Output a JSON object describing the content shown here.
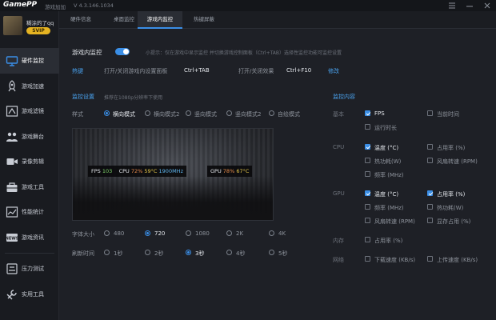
{
  "titlebar": {
    "logo": "GamePP",
    "app_name": "游戏加加",
    "version": "V 4.3.146.1034"
  },
  "user": {
    "name": "糊涂的了qq",
    "badge": "SVIP"
  },
  "sidebar": {
    "items": [
      {
        "label": "硬件监控",
        "icon": "monitor-icon"
      },
      {
        "label": "游戏加速",
        "icon": "rocket-icon"
      },
      {
        "label": "游戏滤镜",
        "icon": "filter-icon"
      },
      {
        "label": "游戏舞台",
        "icon": "stage-icon"
      },
      {
        "label": "录像剪辑",
        "icon": "video-icon"
      },
      {
        "label": "游戏工具",
        "icon": "toolbox-icon"
      },
      {
        "label": "性能统计",
        "icon": "chart-icon"
      },
      {
        "label": "游戏资讯",
        "icon": "news-icon"
      },
      {
        "label": "压力测试",
        "icon": "pressure-icon"
      },
      {
        "label": "实用工具",
        "icon": "tools-icon"
      }
    ]
  },
  "tabs": [
    "硬件信息",
    "桌面监控",
    "游戏内监控",
    "热键屏蔽"
  ],
  "monitor": {
    "title": "游戏内监控",
    "hint": "小提示：仅在游戏中显示监控 并切换游戏控制面板（Ctrl+TAB）选择性监控功能可监控设置",
    "hotkey_label": "热键",
    "hotkey1_desc": "打开/关闭游戏内设置面板",
    "hotkey1_key": "Ctrl+TAB",
    "hotkey2_desc": "打开/关闭效果",
    "hotkey2_key": "Ctrl+F10",
    "modify": "修改"
  },
  "settings": {
    "title": "监控设置",
    "note": "推荐在1080p分辨率下使用",
    "style_label": "样式",
    "styles": [
      "横向模式",
      "横向模式2",
      "竖向模式",
      "竖向模式2",
      "自绘模式"
    ],
    "font_label": "字体大小",
    "font_sizes": [
      "480",
      "720",
      "1080",
      "2K",
      "4K"
    ],
    "refresh_label": "刷新时间",
    "refresh_times": [
      "1秒",
      "2秒",
      "3秒",
      "4秒",
      "5秒"
    ]
  },
  "overlay": {
    "fps_label": "FPS",
    "fps_value": "103",
    "cpu_label": "CPU",
    "cpu_usage": "72%",
    "cpu_temp": "59°C",
    "cpu_freq": "1900MHz",
    "gpu_label": "GPU",
    "gpu_usage": "78%",
    "gpu_temp": "67°C"
  },
  "content": {
    "title": "监控内容",
    "basic_label": "基本",
    "basic_items": [
      "FPS",
      "当前时间",
      "运行时长"
    ],
    "cpu_label": "CPU",
    "cpu_items": [
      "温度 (°C)",
      "占用率 (%)",
      "热功耗(W)",
      "风扇转速 (RPM)",
      "频率 (MHz)"
    ],
    "gpu_label": "GPU",
    "gpu_items": [
      "温度 (°C)",
      "占用率 (%)",
      "频率 (MHz)",
      "热功耗(W)",
      "风扇转速 (RPM)",
      "显存占用 (%)"
    ],
    "mem_label": "内存",
    "mem_items": [
      "占用率 (%)"
    ],
    "net_label": "网络",
    "net_items": [
      "下载速度 (KB/s)",
      "上传速度 (KB/s)"
    ]
  },
  "colors": {
    "accent": "#3a8ee6",
    "background": "#1e2026"
  }
}
